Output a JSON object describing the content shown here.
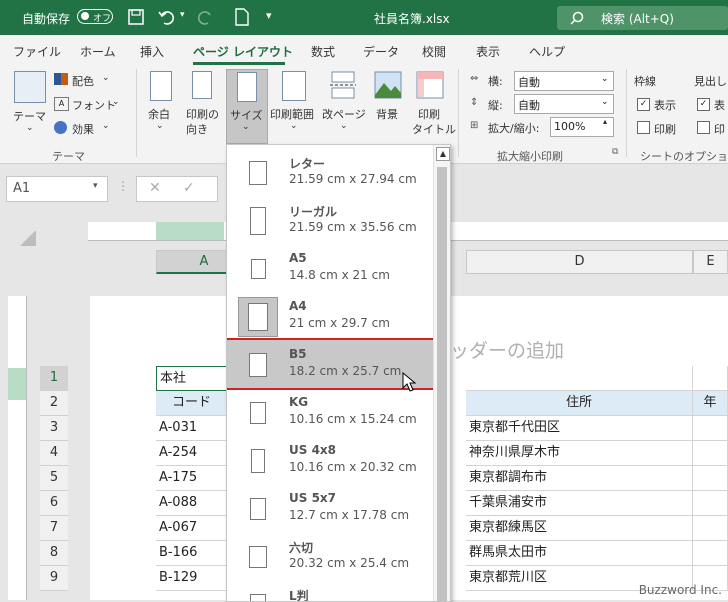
{
  "titlebar": {
    "autosave_label": "自動保存",
    "autosave_state": "オフ",
    "filename": "社員名簿.xlsx",
    "search_placeholder": "検索 (Alt+Q)"
  },
  "tabs": [
    "ファイル",
    "ホーム",
    "挿入",
    "ページ レイアウト",
    "数式",
    "データ",
    "校閲",
    "表示",
    "ヘルプ"
  ],
  "active_tab": "ページ レイアウト",
  "ribbon": {
    "theme_label": "テーマ",
    "colors_label": "配色",
    "fonts_label": "フォント",
    "effects_label": "効果",
    "group_theme": "テーマ",
    "margins_label": "余白",
    "orientation_label_1": "印刷の",
    "orientation_label_2": "向き",
    "size_label": "サイズ",
    "print_area_label": "印刷範囲",
    "breaks_label": "改ページ",
    "background_label": "背景",
    "print_titles_label_1": "印刷",
    "print_titles_label_2": "タイトル",
    "width_label": "横:",
    "width_value": "自動",
    "height_label": "縦:",
    "height_value": "自動",
    "scale_label": "拡大/縮小:",
    "scale_value": "100%",
    "group_scale": "拡大縮小印刷",
    "gridlines_label": "枠線",
    "headings_label": "見出し",
    "view_label": "表示",
    "print_label": "印刷",
    "view_label_2": "表",
    "print_label_2": "印",
    "group_sheet_options": "シートのオプション"
  },
  "namebox": "A1",
  "columns": [
    "A",
    "D",
    "E"
  ],
  "header_placeholder": "ッダーの追加",
  "rows": [
    {
      "num": "1",
      "a": "本社",
      "d": "",
      "e": ""
    },
    {
      "num": "2",
      "a": "コード",
      "d": "住所",
      "e": "年"
    },
    {
      "num": "3",
      "a": "A-031",
      "d": "東京都千代田区",
      "e": ""
    },
    {
      "num": "4",
      "a": "A-254",
      "d": "神奈川県厚木市",
      "e": ""
    },
    {
      "num": "5",
      "a": "A-175",
      "d": "東京都調布市",
      "e": ""
    },
    {
      "num": "6",
      "a": "A-088",
      "d": "千葉県浦安市",
      "e": ""
    },
    {
      "num": "7",
      "a": "A-067",
      "d": "東京都練馬区",
      "e": ""
    },
    {
      "num": "8",
      "a": "B-166",
      "d": "群馬県太田市",
      "e": ""
    },
    {
      "num": "9",
      "a": "B-129",
      "d": "東京都荒川区",
      "e": ""
    }
  ],
  "paper_sizes": [
    {
      "name": "レター",
      "dims": "21.59 cm x 27.94 cm"
    },
    {
      "name": "リーガル",
      "dims": "21.59 cm x 35.56 cm"
    },
    {
      "name": "A5",
      "dims": "14.8 cm x 21 cm"
    },
    {
      "name": "A4",
      "dims": "21 cm x 29.7 cm"
    },
    {
      "name": "B5",
      "dims": "18.2 cm x 25.7 cm"
    },
    {
      "name": "KG",
      "dims": "10.16 cm x 15.24 cm"
    },
    {
      "name": "US 4x8",
      "dims": "10.16 cm x 20.32 cm"
    },
    {
      "name": "US 5x7",
      "dims": "12.7 cm x 17.78 cm"
    },
    {
      "name": "六切",
      "dims": "20.32 cm x 25.4 cm"
    },
    {
      "name": "L判",
      "dims": ""
    }
  ],
  "selected_size": "A4",
  "hovered_size": "B5",
  "watermark": "Buzzword Inc.",
  "colors": {
    "excel_green": "#217346",
    "highlight": "#d02020"
  }
}
